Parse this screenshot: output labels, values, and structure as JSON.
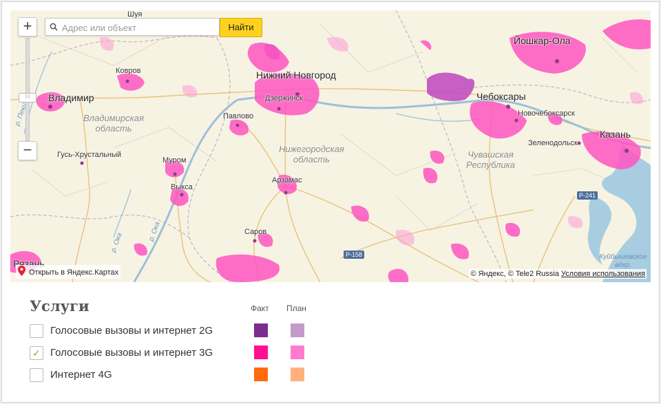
{
  "map": {
    "search": {
      "placeholder": "Адрес или объект",
      "button_label": "Найти"
    },
    "zoom": {
      "in_label": "+",
      "out_label": "−"
    },
    "open_link": "Открыть в Яндекс.Картах",
    "copyright": "© Яндекс, © Tele2 Russia",
    "terms_link": "Условия использования",
    "cities_big": [
      "Йошкар-Ола",
      "Нижний Новгород",
      "Чебоксары",
      "Владимир",
      "Казань",
      "Рязань"
    ],
    "cities_small": [
      "Шуя",
      "Ковров",
      "Дзержинск",
      "Новочебоксарск",
      "Павлово",
      "Зеленодольск",
      "Гусь-Хрустальный",
      "Муром",
      "Выкса",
      "Арзамас",
      "Саров"
    ],
    "regions": [
      "Владимирская область",
      "Нижегородская область",
      "Чувашская Республика"
    ],
    "roads": [
      "Р-241",
      "Р-158"
    ],
    "rivers": [
      "р. Ока",
      "р. Ока",
      "р. Пекша"
    ],
    "water": "Куйбышевское вдхр."
  },
  "services": {
    "title": "Услуги",
    "col_fact": "Факт",
    "col_plan": "План",
    "rows": [
      {
        "label": "Голосовые вызовы и интернет 2G",
        "checked": false,
        "fact_color": "#7b2d8e",
        "plan_color": "#c49ac8"
      },
      {
        "label": "Голосовые вызовы и интернет 3G",
        "checked": true,
        "fact_color": "#ff0f91",
        "plan_color": "#ff7ccc"
      },
      {
        "label": "Интернет 4G",
        "checked": false,
        "fact_color": "#ff6a10",
        "plan_color": "#ffb07d"
      }
    ],
    "check_glyph": "✓"
  },
  "colors": {
    "coverage": "#ff55c0",
    "coverage_dark": "#c050c0",
    "water": "#a8cde0",
    "search_button": "#ffd21d"
  }
}
